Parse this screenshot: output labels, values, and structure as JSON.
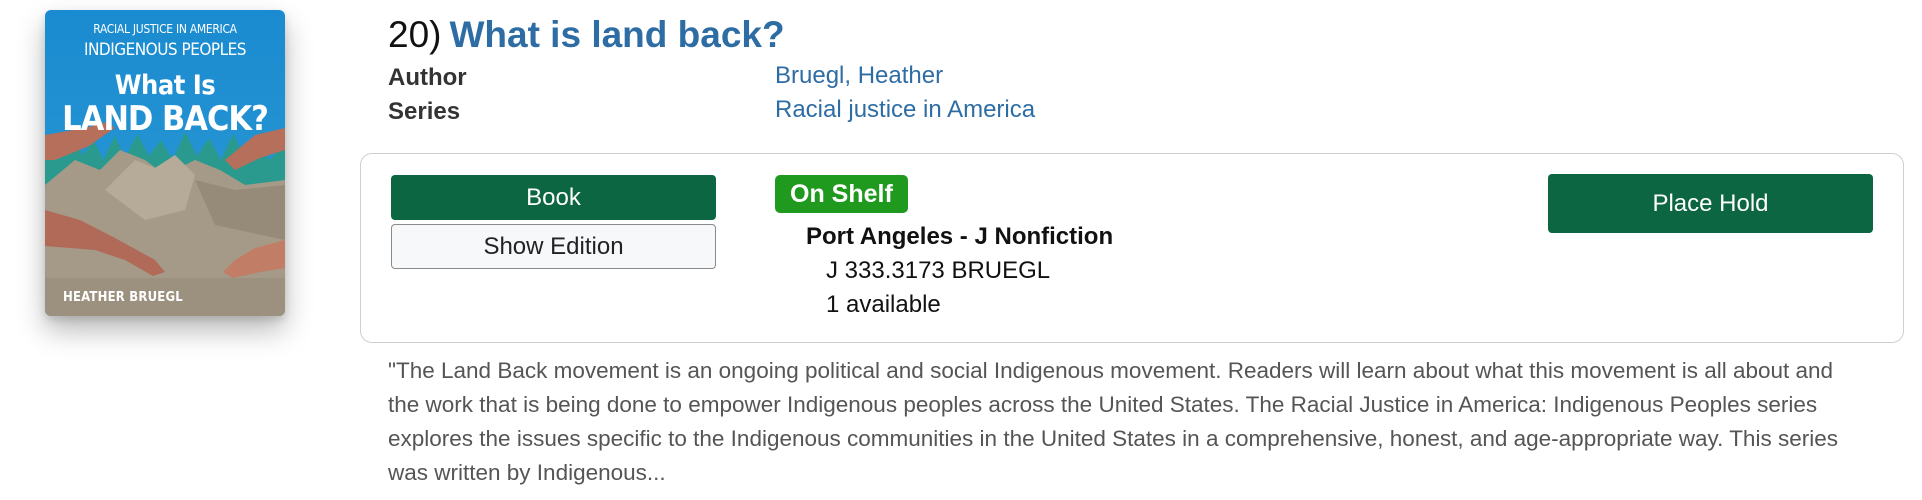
{
  "cover": {
    "series_line1": "RACIAL JUSTICE IN AMERICA",
    "series_line2": "INDIGENOUS PEOPLES",
    "title_line1": "What Is",
    "title_line2": "LAND BACK?",
    "author": "HEATHER BRUEGL",
    "colors": {
      "sky": "#1d8fd0",
      "ground": "#a39684",
      "trees": "#2a8f8a",
      "hands": "#b8735e"
    }
  },
  "result": {
    "number": "20)",
    "title": "What is land back?",
    "author_label": "Author",
    "author_value": "Bruegl, Heather",
    "series_label": "Series",
    "series_value": "Racial justice in America"
  },
  "format": {
    "book_label": "Book",
    "show_edition_label": "Show Edition"
  },
  "availability": {
    "status": "On Shelf",
    "location": "Port Angeles - J Nonfiction",
    "call_number": "J 333.3173 BRUEGL",
    "available": "1 available"
  },
  "actions": {
    "place_hold_label": "Place Hold"
  },
  "description": "\"The Land Back movement is an ongoing political and social Indigenous movement. Readers will learn about what this movement is all about and the work that is being done to empower Indigenous peoples across the United States. The Racial Justice in America: Indigenous Peoples series explores the issues specific to the Indigenous communities in the United States in a comprehensive, honest, and age-appropriate way. This series was written by Indigenous...",
  "theme": {
    "link": "#2e6da4",
    "primary_button": "#0c6641",
    "on_shelf": "#1f9a1f"
  }
}
